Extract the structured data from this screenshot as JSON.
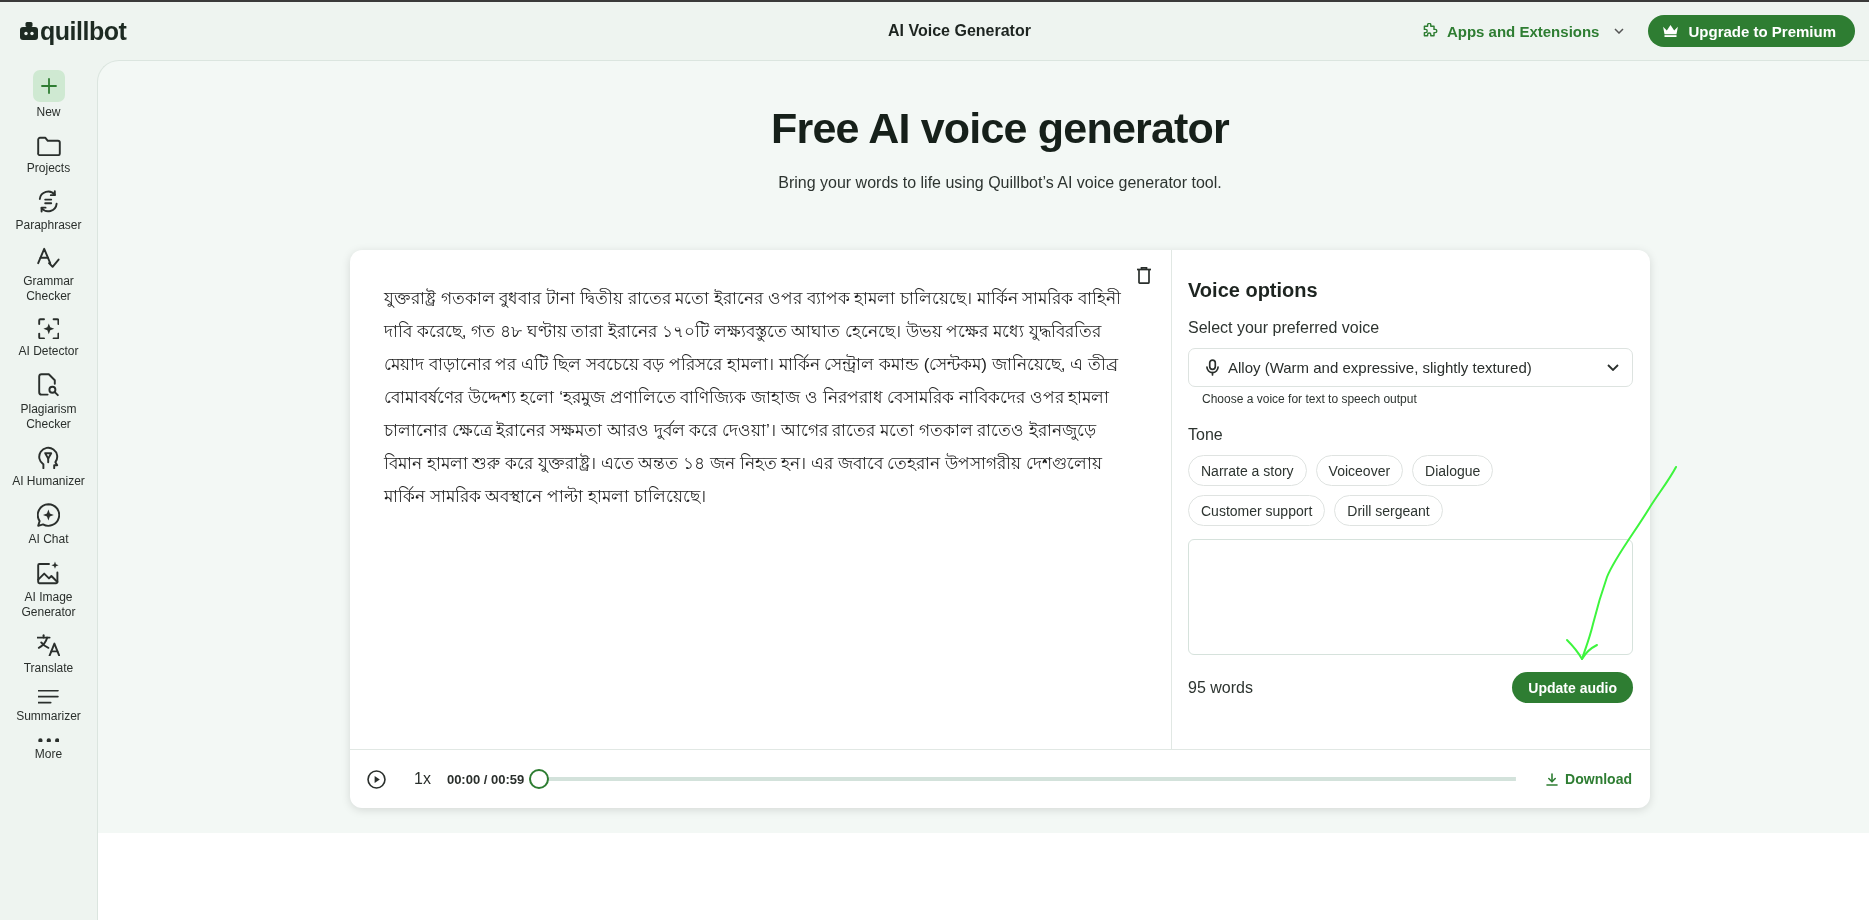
{
  "topbar": {
    "logo": "quillbot",
    "title": "AI Voice Generator",
    "apps_menu": "Apps and Extensions",
    "upgrade_button": "Upgrade to Premium"
  },
  "sidebar": {
    "items": [
      {
        "label": "New",
        "kind": "primary"
      },
      {
        "label": "Projects",
        "kind": "link"
      },
      {
        "label": "Paraphraser",
        "kind": "link"
      },
      {
        "label": "Grammar Checker",
        "kind": "link"
      },
      {
        "label": "AI Detector",
        "kind": "link"
      },
      {
        "label": "Plagiarism Checker",
        "kind": "link"
      },
      {
        "label": "AI Humanizer",
        "kind": "link"
      },
      {
        "label": "AI Chat",
        "kind": "link"
      },
      {
        "label": "AI Image Generator",
        "kind": "link"
      },
      {
        "label": "Translate",
        "kind": "link"
      },
      {
        "label": "Summarizer",
        "kind": "link"
      },
      {
        "label": "More",
        "kind": "link"
      }
    ]
  },
  "hero": {
    "title": "Free AI voice generator",
    "subtitle": "Bring your words to life using Quillbot’s AI voice generator tool."
  },
  "editor": {
    "text": "যুক্তরাষ্ট্র গতকাল বুধবার টানা দ্বিতীয় রাতের মতো ইরানের ওপর ব্যাপক হামলা চালিয়েছে। মার্কিন সামরিক বাহিনী দাবি করেছে, গত ৪৮ ঘণ্টায় তারা ইরানের ১৭০টি লক্ষ্যবস্তুতে আঘাত হেনেছে। উভয় পক্ষের মধ্যে যুদ্ধবিরতির মেয়াদ বাড়ানোর পর এটি ছিল সবচেয়ে বড় পরিসরে হামলা। মার্কিন সেন্ট্রাল কমান্ড (সেন্টকম) জানিয়েছে, এ তীব্র বোমাবর্ষণের উদ্দেশ্য হলো ‘হরমুজ প্রণালিতে বাণিজ্যিক জাহাজ ও নিরপরাধ বেসামরিক নাবিকদের ওপর হামলা চালানোর ক্ষেত্রে ইরানের সক্ষমতা আরও দুর্বল করে দেওয়া’। আগের রাতের মতো গতকাল রাতেও ইরানজুড়ে বিমান হামলা শুরু করে যুক্তরাষ্ট্র। এতে অন্তত ১৪ জন নিহত হন। এর জবাবে তেহরান উপসাগরীয় দেশগুলোয় মার্কিন সামরিক অবস্থানে পাল্টা হামলা চালিয়েছে।"
  },
  "voice_options": {
    "title": "Voice options",
    "voice_label": "Select your preferred voice",
    "voice": "Alloy (Warm and expressive, slightly textured)",
    "voice_helper": "Choose a voice for text to speech output",
    "tone_label": "Tone",
    "tones": [
      {
        "label": "Narrate a story",
        "selected": false
      },
      {
        "label": "Voiceover",
        "selected": false
      },
      {
        "label": "Dialogue",
        "selected": false
      },
      {
        "label": "Customer support",
        "selected": false
      },
      {
        "label": "Drill sergeant",
        "selected": false
      }
    ],
    "word_count": "95 words",
    "update_button": "Update audio"
  },
  "player": {
    "speed": "1x",
    "time": "00:00 / 00:59",
    "level": 0,
    "download": "Download"
  }
}
